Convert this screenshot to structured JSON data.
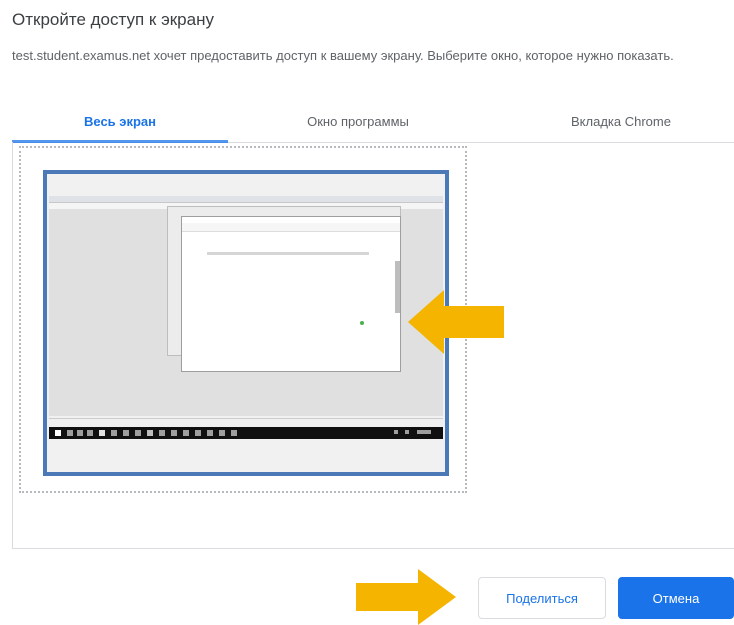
{
  "dialog": {
    "title": "Откройте доступ к экрану",
    "description": "test.student.examus.net хочет предоставить доступ к вашему экрану. Выберите окно, которое нужно показать."
  },
  "tabs": [
    {
      "label": "Весь экран",
      "active": true
    },
    {
      "label": "Окно программы",
      "active": false
    },
    {
      "label": "Вкладка Chrome",
      "active": false
    }
  ],
  "buttons": {
    "share": "Поделиться",
    "cancel": "Отмена"
  },
  "colors": {
    "accent": "#1a73e8",
    "arrow": "#f4b400",
    "thumbnail_border": "#4b79b8"
  },
  "icons": [
    "arrow-left-icon",
    "arrow-right-icon"
  ]
}
